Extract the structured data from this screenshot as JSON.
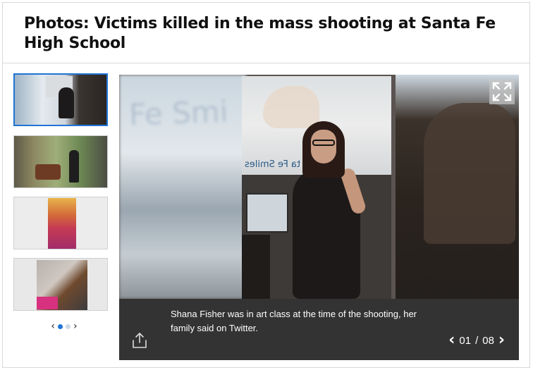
{
  "header": {
    "title": "Photos: Victims killed in the mass shooting at Santa Fe High School"
  },
  "gallery": {
    "thumbnails": [
      {
        "name": "thumb-1",
        "active": true
      },
      {
        "name": "thumb-2",
        "active": false
      },
      {
        "name": "thumb-3",
        "active": false
      },
      {
        "name": "thumb-4",
        "active": false
      }
    ],
    "thumb_nav": {
      "prev": "‹",
      "next": "›",
      "dots": 2,
      "active_dot": 1
    },
    "main_image": {
      "poster_text": "ta Fe Smiles",
      "blur_text": "Fe Smi"
    },
    "caption": "Shana Fisher was in art class at the time of the shooting, her family said on Twitter.",
    "counter": {
      "prev": "‹",
      "current": "01",
      "separator": "/",
      "total": "08",
      "next": "›"
    },
    "colors": {
      "accent": "#1f74d6",
      "caption_bg": "#333333"
    },
    "icons": [
      "expand-icon",
      "share-icon",
      "chevron-left-icon",
      "chevron-right-icon"
    ]
  }
}
